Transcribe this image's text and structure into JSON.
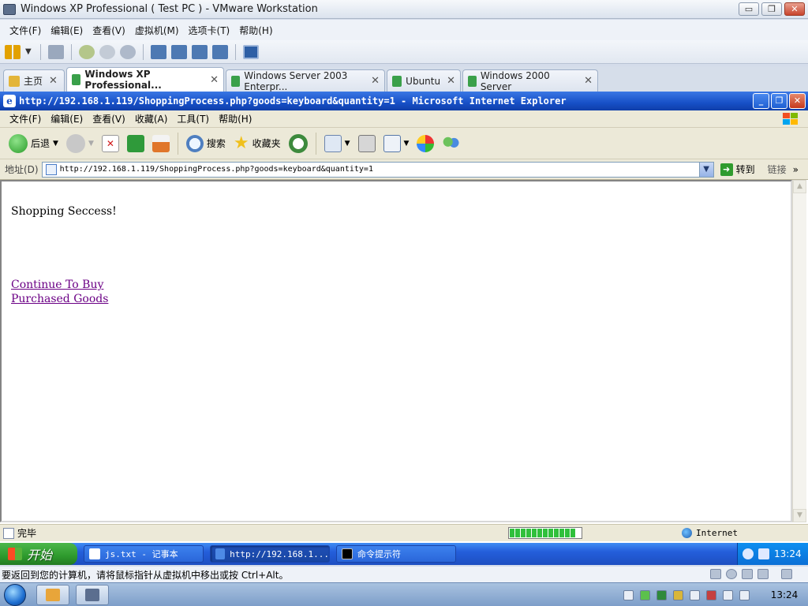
{
  "vmware": {
    "title": "Windows XP Professional ( Test PC ) - VMware Workstation",
    "menu": [
      "文件(F)",
      "编辑(E)",
      "查看(V)",
      "虚拟机(M)",
      "选项卡(T)",
      "帮助(H)"
    ],
    "window_buttons": [
      "▭",
      "❐",
      "✕"
    ],
    "tabs": [
      {
        "label": "主页",
        "close": "✕"
      },
      {
        "label": "Windows XP Professional...",
        "close": "✕"
      },
      {
        "label": "Windows Server 2003 Enterpr...",
        "close": "✕"
      },
      {
        "label": "Ubuntu",
        "close": "✕"
      },
      {
        "label": "Windows 2000 Server",
        "close": "✕"
      }
    ],
    "status_hint": "要返回到您的计算机，请将鼠标指针从虚拟机中移出或按 Ctrl+Alt。"
  },
  "ie": {
    "title": "http://192.168.1.119/ShoppingProcess.php?goods=keyboard&quantity=1 - Microsoft Internet Explorer",
    "menu": [
      "文件(F)",
      "编辑(E)",
      "查看(V)",
      "收藏(A)",
      "工具(T)",
      "帮助(H)"
    ],
    "toolbar": {
      "back": "后退",
      "search": "搜索",
      "favorites": "收藏夹"
    },
    "address_label": "地址(D)",
    "address_value": "http://192.168.1.119/ShoppingProcess.php?goods=keyboard&quantity=1",
    "go_label": "转到",
    "links_label": "链接",
    "links_more": "»",
    "content": {
      "message": "Shopping Seccess!",
      "links": [
        "Continue To Buy",
        "Purchased Goods"
      ]
    },
    "status": {
      "text": "完毕",
      "zone": "Internet"
    }
  },
  "xp_taskbar": {
    "start": "开始",
    "tasks": [
      "js.txt - 记事本",
      "http://192.168.1...",
      "命令提示符"
    ],
    "clock": "13:24"
  },
  "host_taskbar": {
    "clock": "13:24"
  }
}
